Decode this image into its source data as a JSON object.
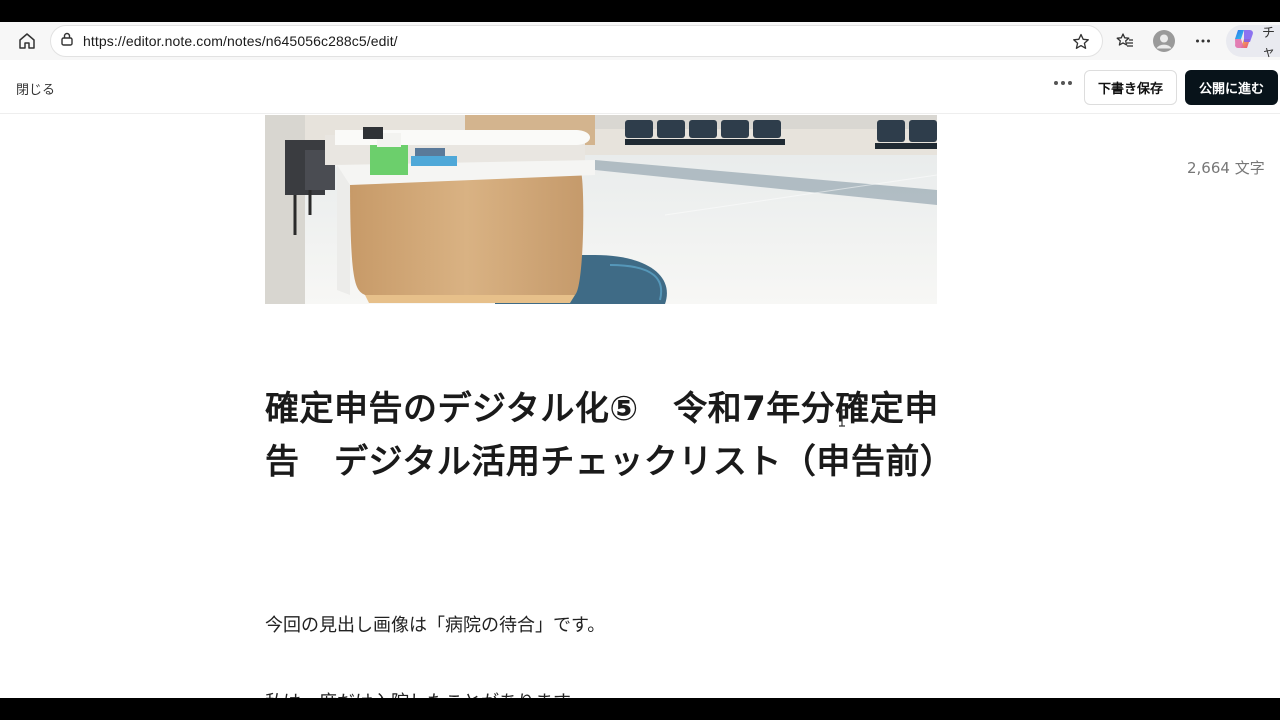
{
  "browser": {
    "url": "https://editor.note.com/notes/n645056c288c5/edit/",
    "copilot_label": "チャ",
    "icons": [
      "home-icon",
      "lock-icon",
      "star-icon",
      "favorites-icon",
      "profile-icon",
      "more-icon",
      "copilot-icon"
    ]
  },
  "editor": {
    "close_label": "閉じる",
    "draft_label": "下書き保存",
    "publish_label": "公開に進む",
    "char_count": "2,664 文字"
  },
  "article": {
    "title": "確定申告のデジタル化⑤　令和7年分確定申告　デジタル活用チェックリスト（申告前）",
    "paragraphs": [
      "今回の見出し画像は「病院の待合」です。",
      "私は一度だけ入院したことがあります。"
    ]
  },
  "colors": {
    "publish_bg": "#08131a",
    "page_bg": "#ffffff",
    "chrome_bg": "#f7f7f7"
  }
}
